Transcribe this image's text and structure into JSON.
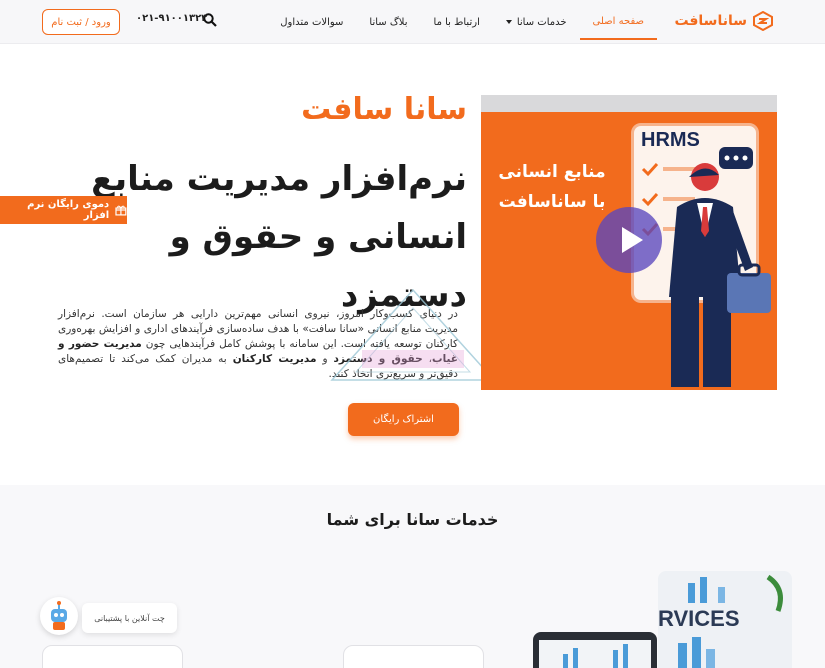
{
  "header": {
    "brand": "ساناسافت",
    "nav": [
      {
        "label": "صفحه اصلی",
        "active": true
      },
      {
        "label": "خدمات سانا",
        "dropdown": true
      },
      {
        "label": "ارتباط با ما"
      },
      {
        "label": "بلاگ سانا"
      },
      {
        "label": "سوالات متداول"
      }
    ],
    "phone": "۰۲۱-۹۱۰۰۱۳۲۳",
    "login": "ورود / ثبت نام"
  },
  "hero": {
    "brand": "سانا سافت",
    "title": "نرم‌افزار مدیریت منابع انسانی و حقوق و دستمزد",
    "desc_1": "در دنیای کسب‌وکار امروز، نیروی انسانی مهم‌ترین دارایی هر سازمان است. نرم‌افزار مدیریت منابع انسانی «سانا سافت» با هدف ساده‌سازی فرآیندهای اداری و افزایش بهره‌وری کارکنان توسعه یافته است. این سامانه با پوشش کامل فرآیندهایی چون",
    "desc_bold_1": "مدیریت حضور و غیاب",
    "desc_sep": "،",
    "desc_bold_2": "حقوق و دستمزد",
    "desc_and": "و",
    "desc_bold_3": "مدیریت کارکنان",
    "desc_2": "به مدیران کمک می‌کند تا تصمیم‌های دقیق‌تر و سریع‌تری اتخاذ کنند.",
    "cta": "اشتراک رایگان",
    "image_text_1": "منابع انسانی",
    "image_text_2": "با ساناسافت",
    "image_board": "HRMS"
  },
  "demo_badge": "دموی رایگان نرم افزار",
  "services": {
    "title": "خدمات سانا برای شما",
    "image_text": "RVICES"
  },
  "chat": {
    "label": "چت آنلاین با پشتیبانی"
  },
  "colors": {
    "accent": "#f26b1d",
    "dark": "#1c1c1c",
    "header_bg": "#f7f7f9"
  }
}
